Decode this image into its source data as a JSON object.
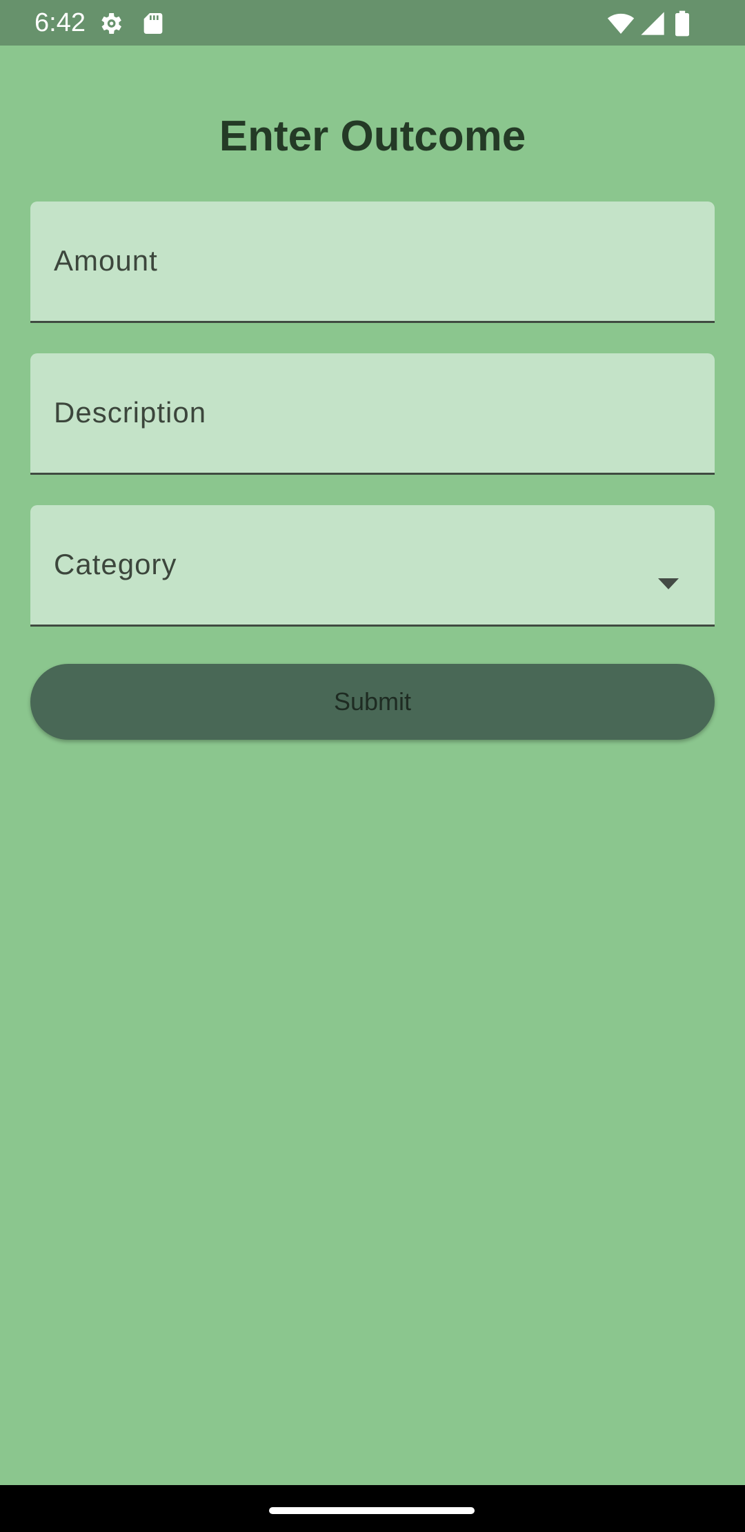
{
  "status_bar": {
    "time": "6:42",
    "left_icons": [
      "settings-gear-icon",
      "sd-card-icon"
    ],
    "right_icons": [
      "wifi-icon",
      "cellular-signal-icon",
      "battery-icon"
    ]
  },
  "page": {
    "title": "Enter Outcome"
  },
  "form": {
    "amount_label": "Amount",
    "description_label": "Description",
    "category_label": "Category",
    "submit_label": "Submit"
  },
  "colors": {
    "background": "#8BC68E",
    "status_bar": "#67926C",
    "field_fill": "#C4E3C8",
    "button": "#496856",
    "title_text": "#243A26"
  }
}
